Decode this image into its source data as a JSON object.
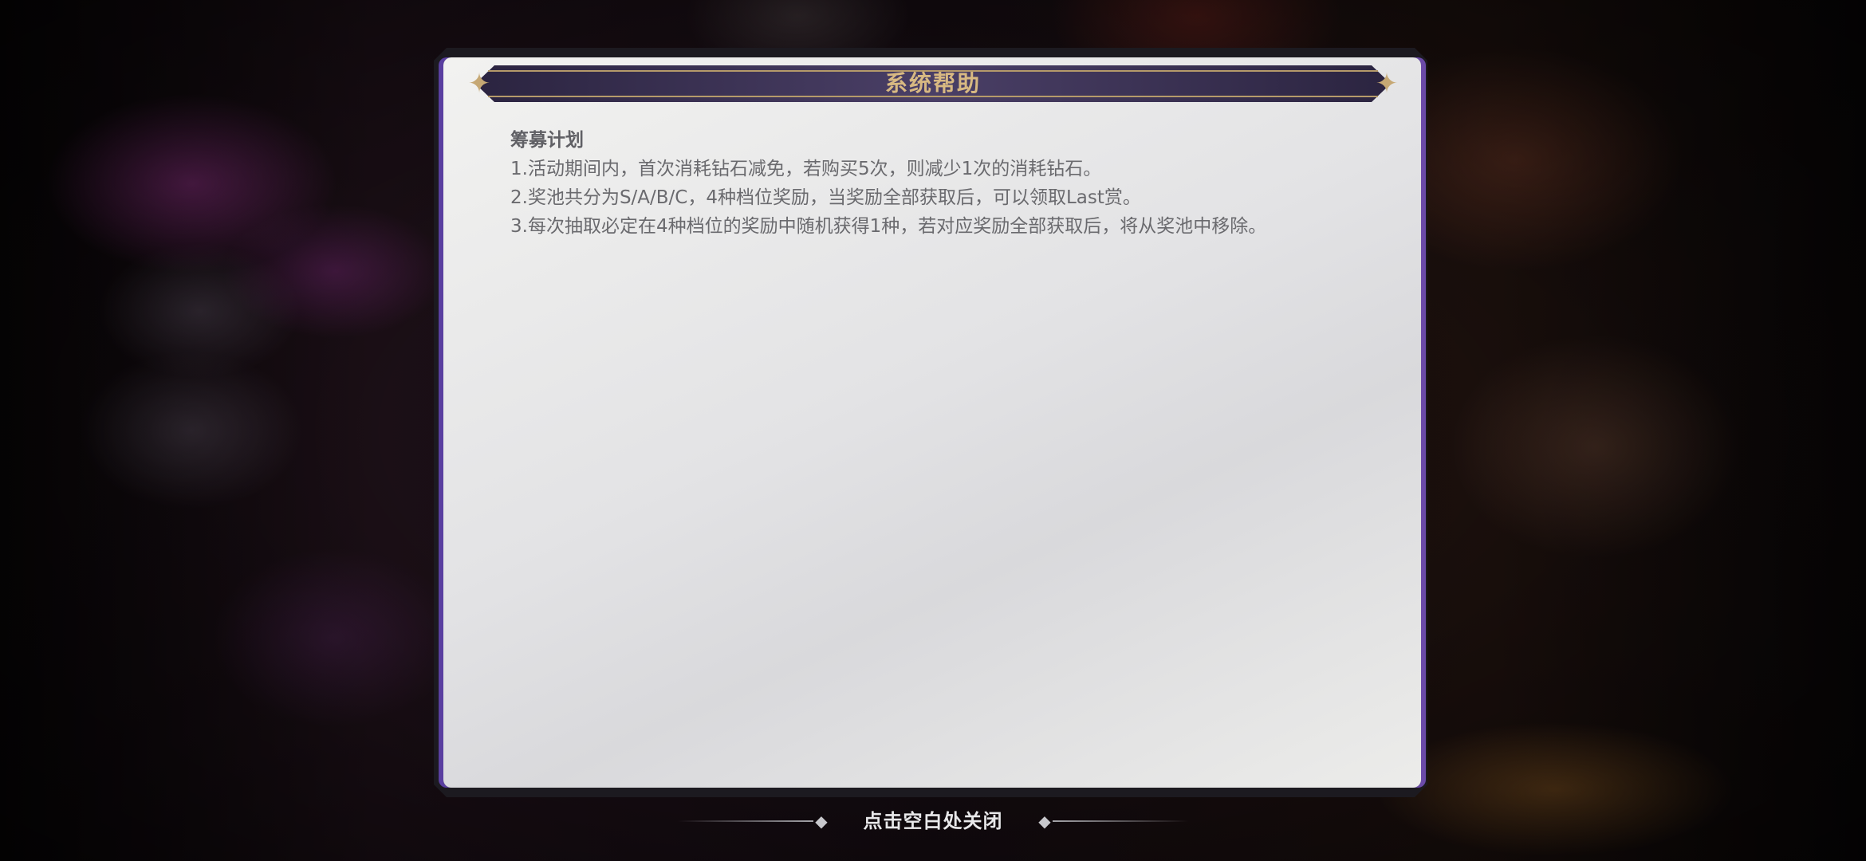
{
  "dialog": {
    "title": "系统帮助",
    "heading": "筹募计划",
    "lines": [
      "1.活动期间内，首次消耗钻石减免，若购买5次，则减少1次的消耗钻石。",
      "2.奖池共分为S/A/B/C，4种档位奖励，当奖励全部获取后，可以领取Last赏。",
      "3.每次抽取必定在4种档位的奖励中随机获得1种，若对应奖励全部获取后，将从奖池中移除。"
    ]
  },
  "footer": {
    "close_hint": "点击空白处关闭"
  },
  "icons": {
    "title_ornament": "star-ornament-icon",
    "hint_ornament": "diamond-icon"
  },
  "colors": {
    "title_text": "#d8b982",
    "title_bar": "#2b2440",
    "panel_bg": "#eaeaea",
    "panel_accent": "#6b4aa8",
    "body_text": "#6a6a6e"
  }
}
